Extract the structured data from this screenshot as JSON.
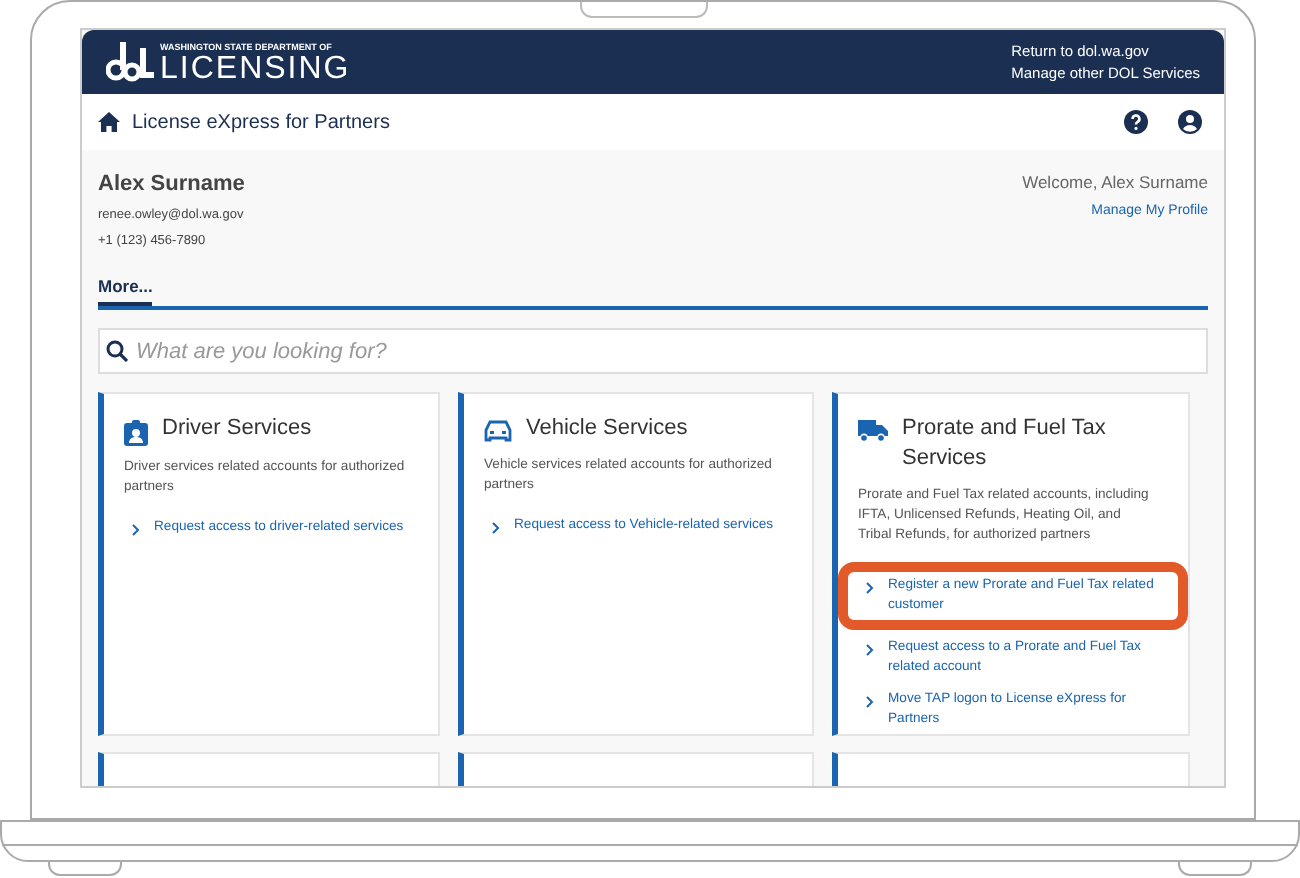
{
  "header": {
    "agency_line": "WASHINGTON STATE DEPARTMENT OF",
    "agency_name": "LICENSING",
    "links": [
      "Return to dol.wa.gov",
      "Manage other DOL Services"
    ]
  },
  "nav": {
    "title": "License eXpress for Partners"
  },
  "profile": {
    "name": "Alex Surname",
    "email": "renee.owley@dol.wa.gov",
    "phone": "+1 (123) 456-7890",
    "welcome": "Welcome, Alex Surname",
    "manage_link": "Manage My Profile",
    "more": "More..."
  },
  "search": {
    "placeholder": "What are you looking for?"
  },
  "cards": [
    {
      "kind": "driver",
      "title": "Driver Services",
      "description": "Driver services related accounts for authorized partners",
      "links": [
        {
          "text": "Request access to driver-related services",
          "highlighted": false
        }
      ]
    },
    {
      "kind": "vehicle",
      "title": "Vehicle Services",
      "description": "Vehicle services related accounts for authorized partners",
      "links": [
        {
          "text": "Request access to Vehicle-related services",
          "highlighted": false
        }
      ]
    },
    {
      "kind": "truck",
      "title": "Prorate and Fuel Tax Services",
      "description": "Prorate and Fuel Tax related accounts, including IFTA, Unlicensed Refunds, Heating Oil, and Tribal Refunds, for authorized partners",
      "links": [
        {
          "text": "Register a new Prorate and Fuel Tax related customer",
          "highlighted": true
        },
        {
          "text": "Request access to a Prorate and Fuel Tax related account",
          "highlighted": false
        },
        {
          "text": "Move TAP logon to License eXpress for Partners",
          "highlighted": false
        }
      ]
    }
  ]
}
